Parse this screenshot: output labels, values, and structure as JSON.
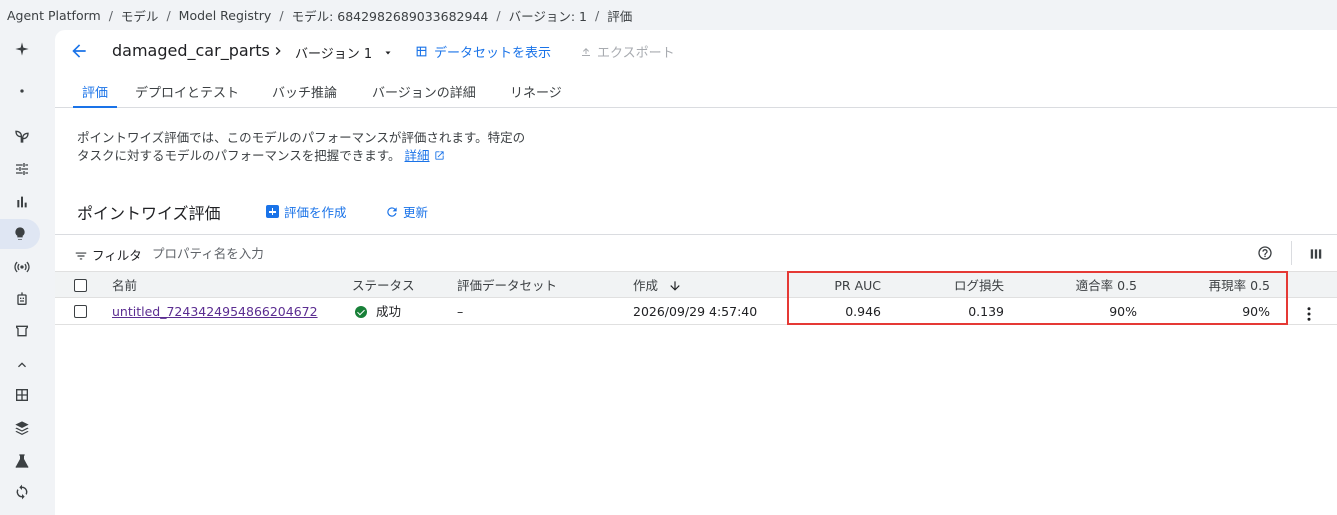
{
  "breadcrumb": [
    "Agent Platform",
    "モデル",
    "Model Registry",
    "モデル: 6842982689033682944",
    "バージョン: 1",
    "評価"
  ],
  "header": {
    "title": "damaged_car_parts",
    "version_label": "バージョン 1",
    "dataset_button": "データセットを表示",
    "export_button": "エクスポート"
  },
  "tabs": [
    "評価",
    "デプロイとテスト",
    "バッチ推論",
    "バージョンの詳細",
    "リネージ"
  ],
  "description": {
    "line1": "ポイントワイズ評価では、このモデルのパフォーマンスが評価されます。特定の",
    "line2": "タスクに対するモデルのパフォーマンスを把握できます。",
    "link": "詳細"
  },
  "section": {
    "title": "ポイントワイズ評価",
    "create_button": "評価を作成",
    "refresh_button": "更新"
  },
  "filter": {
    "label": "フィルタ",
    "placeholder": "プロパティ名を入力"
  },
  "table": {
    "columns": [
      "名前",
      "ステータス",
      "評価データセット",
      "作成",
      "PR AUC",
      "ログ損失",
      "適合率 0.5",
      "再現率 0.5"
    ],
    "rows": [
      {
        "name": "untitled_7243424954866204672",
        "status": "成功",
        "dataset": "–",
        "created": "2026/09/29 4:57:40",
        "pr_auc": "0.946",
        "log_loss": "0.139",
        "precision": "90%",
        "recall": "90%"
      }
    ]
  },
  "colors": {
    "accent": "#1a73e8",
    "success": "#188038",
    "highlight": "#e53935",
    "visited_link": "#5b2d91"
  },
  "icons": {
    "sidebar": [
      "sparkle-icon",
      "dot-icon",
      "sprout-icon",
      "tune-icon",
      "bar-chart-icon",
      "lightbulb-icon",
      "broadcast-icon",
      "robot-icon",
      "shop-icon",
      "chevron-up-icon",
      "grid-icon",
      "layers-icon",
      "flask-icon",
      "sync-icon"
    ]
  }
}
